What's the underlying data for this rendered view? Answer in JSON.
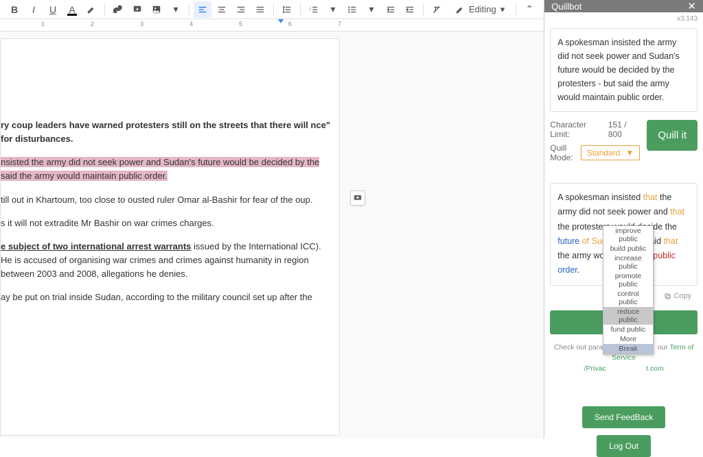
{
  "toolbar": {
    "editing_label": "Editing"
  },
  "ruler_ticks": [
    "1",
    "2",
    "3",
    "4",
    "5",
    "6",
    "7"
  ],
  "doc": {
    "p1a": "ry coup leaders have warned protesters still on the streets that there will ",
    "p1b": "nce\" for disturbances.",
    "p2a": "nsisted the army did not seek power and Sudan's future would be decided by the ",
    "p2b": "said the army would maintain public order.",
    "p3": "till out in Khartoum, too close to ousted ruler Omar al-Bashir for fear of the oup.",
    "p4": "s it will not extradite Mr Bashir on war crimes charges.",
    "p5a": "e subject of two international arrest warrants",
    "p5b": " issued by the International ICC). He is accused of organising war crimes and crimes against humanity in region between 2003 and 2008, allegations he denies.",
    "p6": "ay be put on trial inside Sudan, according to the military council set up after the"
  },
  "panel": {
    "title": "Quillbot",
    "version": "v3.143",
    "input_text": "A spokesman insisted the army did not seek power and Sudan's future would be decided by the protesters - but said the army would maintain public order.",
    "char_label": "Character Limit:",
    "char_value": "151 / 800",
    "mode_label": "Quill Mode:",
    "mode_value": "Standard",
    "quill_btn": "Quill it",
    "out": {
      "t1": "A spokesman insisted ",
      "that1": "that",
      "t2": " the army did not seek power and ",
      "that2": "that",
      "t3": " the protesters would decide the ",
      "future": "future",
      "of": " of Sudan-but",
      "t4": " he said ",
      "that3": "that",
      "t5": " the army would ",
      "maintain": "maintain public",
      "order": " order",
      "dot": "."
    },
    "copy_label": "Copy",
    "insert_label": "Insert",
    "footer1": "Check out paragraph",
    "footer2": "our ",
    "tos": "Term of Service",
    "priv": "/Privac",
    "site": "t.com",
    "feedback": "Send FeedBack",
    "logout": "Log Out"
  },
  "dropdown": {
    "items": [
      "improve public",
      "build public",
      "increase public",
      "promote public",
      "control public",
      "reduce public",
      "fund public",
      "More",
      "Break"
    ],
    "selected": 5,
    "selected2": 8
  }
}
